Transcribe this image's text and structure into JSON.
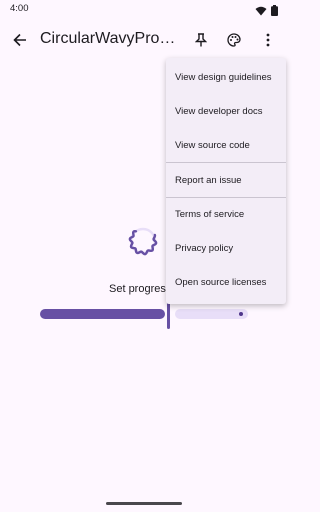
{
  "status_bar": {
    "time": "4:00",
    "icons": [
      "wifi-icon",
      "battery-icon"
    ]
  },
  "app_bar": {
    "title": "CircularWavyProgressIndicator",
    "icons": [
      "back-arrow-icon",
      "pin-icon",
      "palette-icon",
      "more-vert-icon"
    ]
  },
  "content": {
    "progress_label": "Set progress",
    "slider_value_fraction": 0.6
  },
  "menu": {
    "items": [
      "View design guidelines",
      "View developer docs",
      "View source code",
      "Report an issue",
      "Terms of service",
      "Privacy policy",
      "Open source licenses"
    ]
  },
  "colors": {
    "background": "#fef7ff",
    "primary": "#6750a4",
    "secondary_container": "#e8def8",
    "menu_surface": "#f3edf7"
  }
}
